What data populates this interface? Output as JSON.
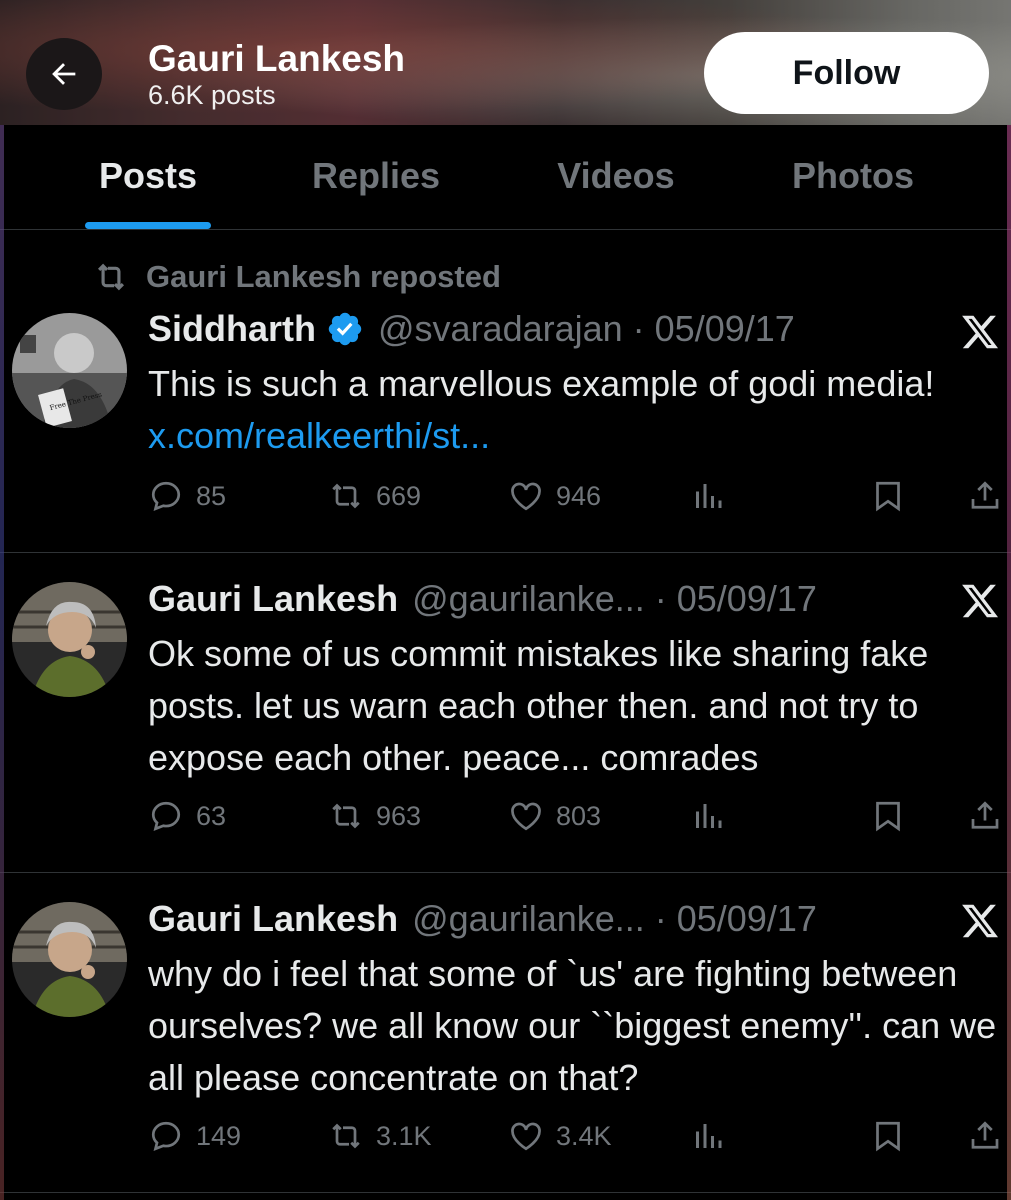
{
  "header": {
    "back_icon": "arrow-left-icon",
    "name": "Gauri Lankesh",
    "post_count": "6.6K posts",
    "follow_label": "Follow"
  },
  "tabs": [
    {
      "label": "Posts",
      "active": true
    },
    {
      "label": "Replies",
      "active": false
    },
    {
      "label": "Videos",
      "active": false
    },
    {
      "label": "Photos",
      "active": false
    }
  ],
  "accent_color": "#1d9bf0",
  "posts": [
    {
      "repost_context": "Gauri Lankesh reposted",
      "author": "Siddharth",
      "verified": true,
      "handle": "@svaradarajan · 05/09/17",
      "text": "This is such a marvellous example of godi media! ",
      "link": "x.com/realkeerthi/st...",
      "replies": "85",
      "reposts": "669",
      "likes": "946",
      "avatar_label": "Free The Press"
    },
    {
      "author": "Gauri Lankesh",
      "handle": "@gaurilanke... · 05/09/17",
      "text": "Ok some of us commit mistakes like sharing fake posts. let us warn each other then. and not try to expose each other. peace... comrades",
      "replies": "63",
      "reposts": "963",
      "likes": "803"
    },
    {
      "author": "Gauri Lankesh",
      "handle": "@gaurilanke... · 05/09/17",
      "text": "why do i feel that some of `us' are fighting between ourselves? we all know our ``biggest enemy''. can we all please concentrate on that?",
      "replies": "149",
      "reposts": "3.1K",
      "likes": "3.4K"
    }
  ]
}
